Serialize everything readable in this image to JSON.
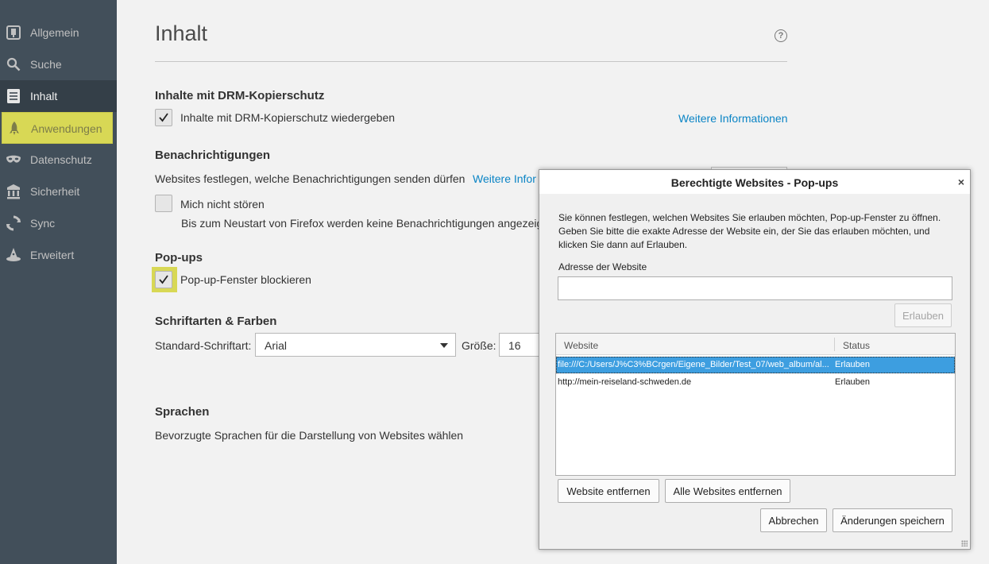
{
  "sidebar": {
    "items": [
      {
        "label": "Allgemein",
        "icon": "general-icon"
      },
      {
        "label": "Suche",
        "icon": "search-icon"
      },
      {
        "label": "Inhalt",
        "icon": "content-icon"
      },
      {
        "label": "Anwendungen",
        "icon": "rocket-icon"
      },
      {
        "label": "Datenschutz",
        "icon": "mask-icon"
      },
      {
        "label": "Sicherheit",
        "icon": "lock-icon"
      },
      {
        "label": "Sync",
        "icon": "sync-icon"
      },
      {
        "label": "Erweitert",
        "icon": "wizard-hat-icon"
      }
    ],
    "selected": "Inhalt"
  },
  "main": {
    "title": "Inhalt",
    "drm": {
      "heading": "Inhalte mit DRM-Kopierschutz",
      "checkbox_label": "Inhalte mit DRM-Kopierschutz wiedergeben",
      "checked": true,
      "link": "Weitere Informationen"
    },
    "notifications": {
      "heading": "Benachrichtigungen",
      "description": "Websites festlegen, welche Benachrichtigungen senden dürfen",
      "link": "Weitere Infor",
      "dnd_label": "Mich nicht stören",
      "dnd_note": "Bis zum Neustart von Firefox werden keine Benachrichtigungen angezeigt."
    },
    "popups": {
      "heading": "Pop-ups",
      "checkbox_label": "Pop-up-Fenster blockieren",
      "checked": true
    },
    "fonts": {
      "heading": "Schriftarten & Farben",
      "default_font_label": "Standard-Schriftart:",
      "default_font_value": "Arial",
      "size_label": "Größe:",
      "size_value": "16"
    },
    "languages": {
      "heading": "Sprachen",
      "description": "Bevorzugte Sprachen für die Darstellung von Websites wählen"
    }
  },
  "dialog": {
    "title": "Berechtigte Websites - Pop-ups",
    "close": "×",
    "description": "Sie können festlegen, welchen Websites Sie erlauben möchten, Pop-up-Fenster zu öffnen. Geben Sie bitte die exakte Adresse der Website ein, der Sie das erlauben möchten, und klicken Sie dann auf Erlauben.",
    "address_label": "Adresse der Website",
    "address_value": "",
    "allow_button": "Erlauben",
    "columns": [
      "Website",
      "Status"
    ],
    "rows": [
      {
        "website": "file:///C:/Users/J%C3%BCrgen/Eigene_Bilder/Test_07/web_album/al...",
        "status": "Erlauben",
        "selected": true
      },
      {
        "website": "http://mein-reiseland-schweden.de",
        "status": "Erlauben",
        "selected": false
      }
    ],
    "remove_button": "Website entfernen",
    "remove_all_button": "Alle Websites entfernen",
    "cancel_button": "Abbrechen",
    "save_button": "Änderungen speichern"
  },
  "colors": {
    "sidebar_bg": "#424f5a",
    "highlight": "#d8d855",
    "link": "#0a84c5",
    "selection": "#3d9ee0"
  }
}
